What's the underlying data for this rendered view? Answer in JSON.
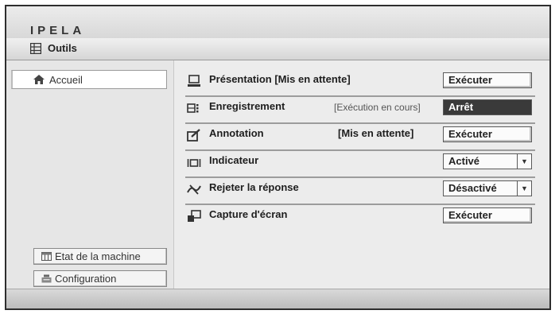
{
  "header": {
    "logo": "IPELA"
  },
  "toolbar": {
    "title": "Outils",
    "icon": "grid-icon"
  },
  "sidebar": {
    "home_label": "Accueil",
    "bottom_buttons": [
      {
        "label": "Etat de la machine",
        "icon": "machine-status-icon"
      },
      {
        "label": "Configuration",
        "icon": "configuration-icon"
      }
    ]
  },
  "main": {
    "rows": [
      {
        "label": "Présentation [Mis en attente]",
        "status": "",
        "control": "Exécuter",
        "icon": "presentation-icon"
      },
      {
        "label": "Enregistrement",
        "status": "[Exécution en cours]",
        "control": "Arrêt",
        "icon": "recording-icon"
      },
      {
        "label": "Annotation",
        "status": "[Mis en attente]",
        "control": "Exécuter",
        "icon": "annotation-icon"
      },
      {
        "label": "Indicateur",
        "status": "",
        "control": "Activé",
        "icon": "indicator-icon"
      },
      {
        "label": "Rejeter la réponse",
        "status": "",
        "control": "Désactivé",
        "icon": "reject-response-icon"
      },
      {
        "label": "Capture d'écran",
        "status": "",
        "control": "Exécuter",
        "icon": "screen-capture-icon"
      }
    ]
  },
  "colors": {
    "frame": "#2e2e2e",
    "panel": "#ececec",
    "active_button": "#3a3a3a"
  }
}
